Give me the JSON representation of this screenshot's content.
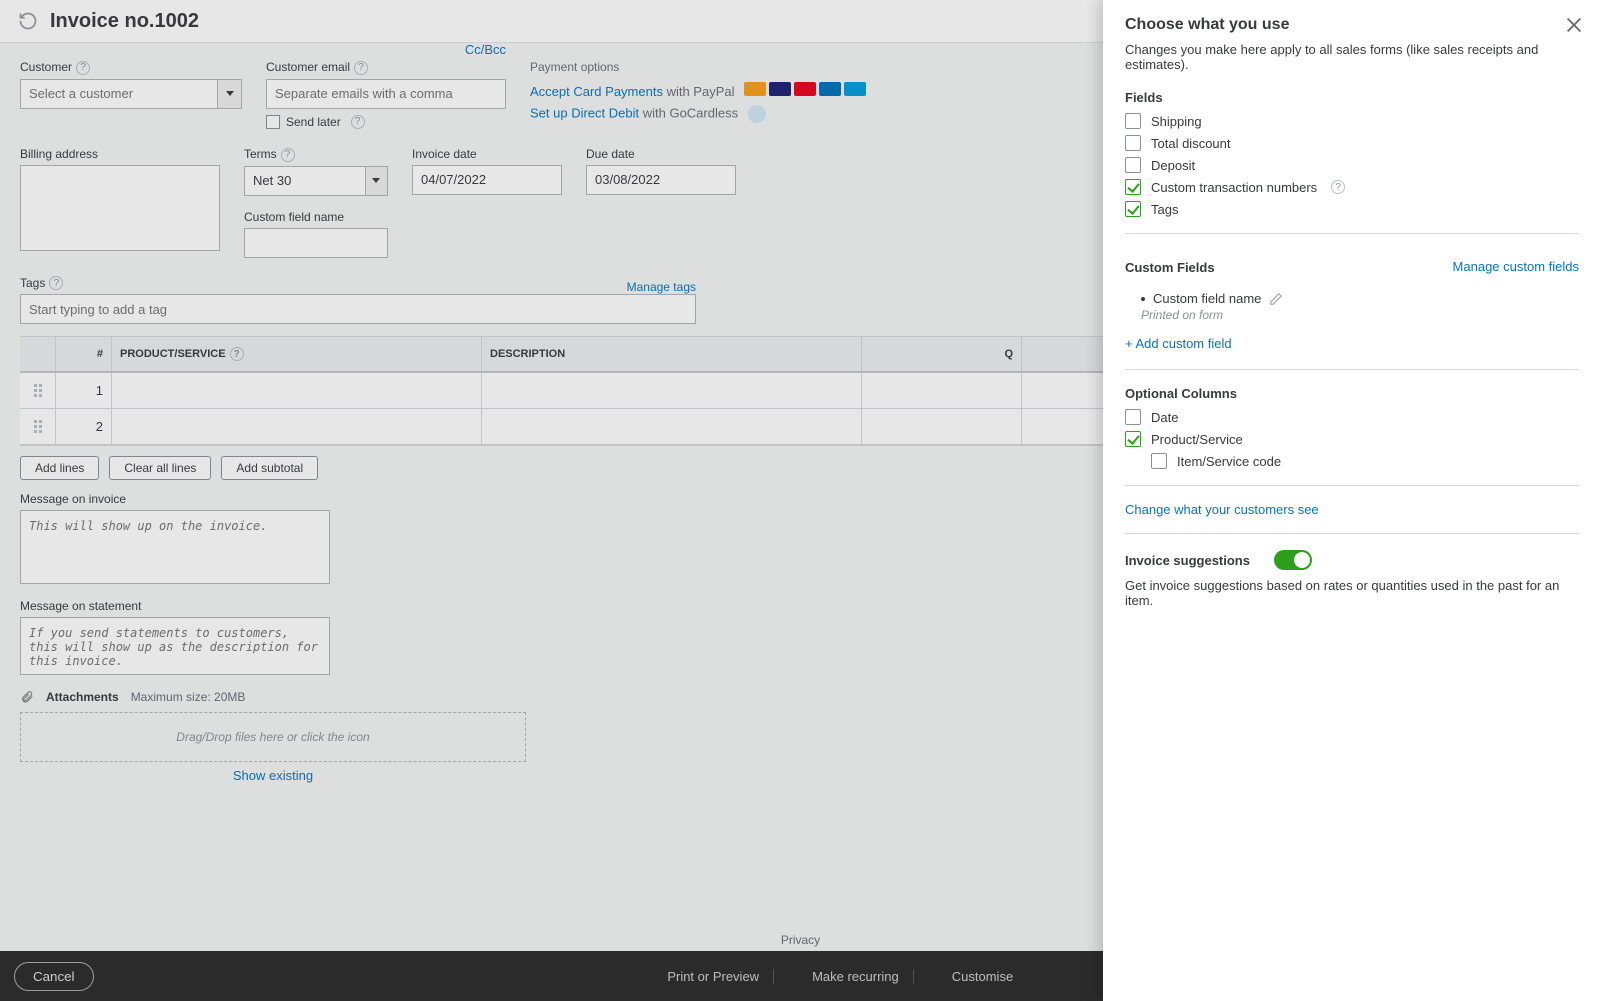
{
  "header": {
    "title": "Invoice no.1002"
  },
  "form": {
    "customer_label": "Customer",
    "customer_placeholder": "Select a customer",
    "email_label": "Customer email",
    "email_placeholder": "Separate emails with a comma",
    "cc_label": "Cc/Bcc",
    "send_later_label": "Send later",
    "payment_options_label": "Payment options",
    "accept_card_link": "Accept Card Payments",
    "accept_card_suffix": " with PayPal",
    "debit_link": "Set up Direct Debit",
    "debit_suffix": " with GoCardless",
    "billing_label": "Billing address",
    "terms_label": "Terms",
    "terms_value": "Net 30",
    "invoice_date_label": "Invoice date",
    "invoice_date_value": "04/07/2022",
    "due_date_label": "Due date",
    "due_date_value": "03/08/2022",
    "custom_field_label": "Custom field name",
    "tags_label": "Tags",
    "manage_tags": "Manage tags",
    "tags_placeholder": "Start typing to add a tag"
  },
  "table": {
    "col_num": "#",
    "col_prod": "PRODUCT/SERVICE",
    "col_desc": "DESCRIPTION",
    "col_qty": "Q",
    "rows": [
      "1",
      "2"
    ]
  },
  "buttons": {
    "add_lines": "Add lines",
    "clear_all": "Clear all lines",
    "add_subtotal": "Add subtotal"
  },
  "messages": {
    "on_invoice_label": "Message on invoice",
    "on_invoice_placeholder": "This will show up on the invoice.",
    "on_statement_label": "Message on statement",
    "on_statement_placeholder": "If you send statements to customers, this will show up as the description for this invoice."
  },
  "attachments": {
    "label": "Attachments",
    "max": "Maximum size: 20MB",
    "drop": "Drag/Drop files here or click the icon",
    "show_existing": "Show existing"
  },
  "footer": {
    "privacy": "Privacy",
    "cancel": "Cancel",
    "print": "Print or Preview",
    "recurring": "Make recurring",
    "customise": "Customise"
  },
  "drawer": {
    "title": "Choose what you use",
    "sub": "Changes you make here apply to all sales forms (like sales receipts and estimates).",
    "fields_title": "Fields",
    "fields": {
      "shipping": "Shipping",
      "total_discount": "Total discount",
      "deposit": "Deposit",
      "custom_txn": "Custom transaction numbers",
      "tags": "Tags"
    },
    "custom_fields_title": "Custom Fields",
    "manage_custom_fields": "Manage custom fields",
    "custom_field_item": "Custom field name",
    "custom_field_sub": "Printed on form",
    "add_custom_field": "+ Add custom field",
    "optional_columns_title": "Optional Columns",
    "optional": {
      "date": "Date",
      "product_service": "Product/Service",
      "item_code": "Item/Service code"
    },
    "change_customers": "Change what your customers see",
    "suggestions_title": "Invoice suggestions",
    "suggestions_note": "Get invoice suggestions based on rates or quantities used in the past for an item."
  }
}
